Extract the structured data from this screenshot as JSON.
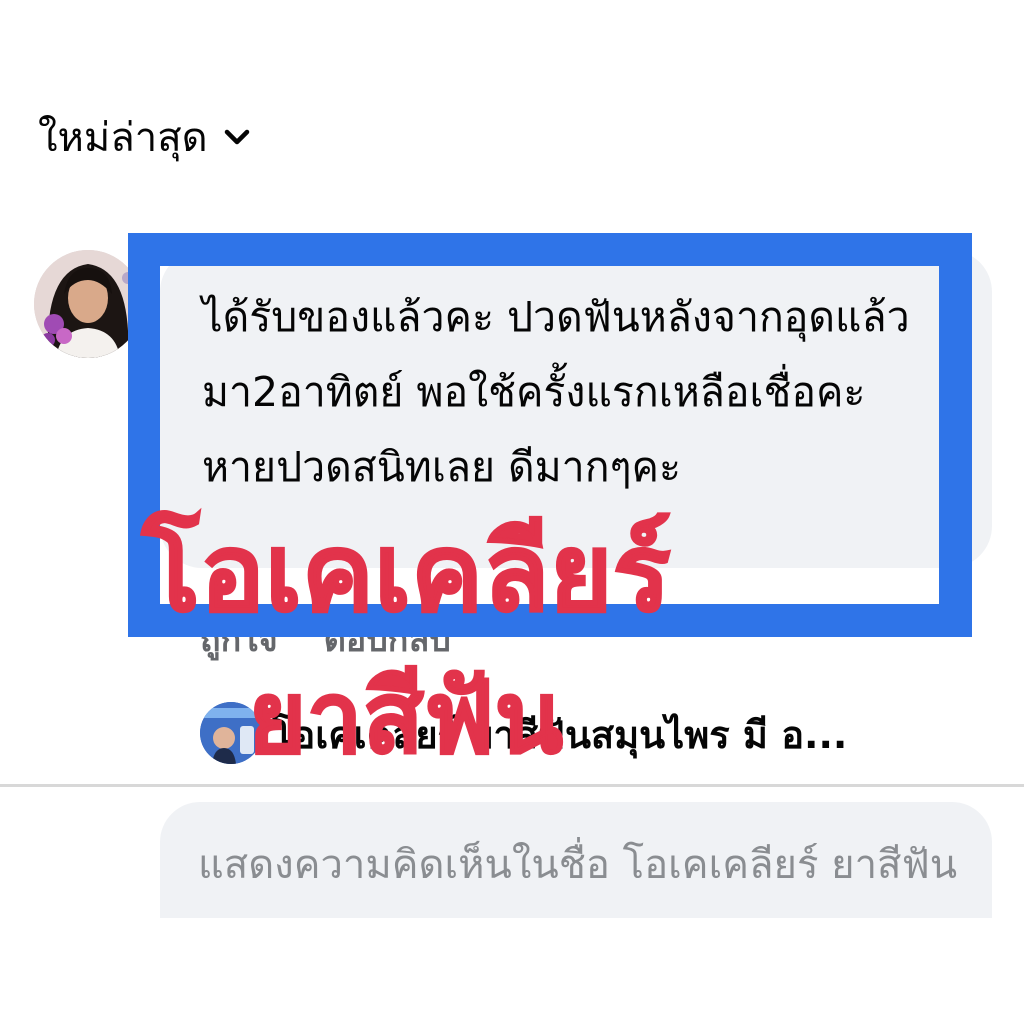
{
  "sort": {
    "label": "ใหม่ล่าสุด",
    "icon": "chevron-down-icon"
  },
  "comment": {
    "avatar_icon": "user-avatar",
    "text": "ได้รับของแล้วคะ ปวดฟันหลังจากอุดแล้วมา2อาทิตย์ พอใช้ครั้งแรกเหลือเชื่อคะ หายปวดสนิทเลย ดีมากๆคะ",
    "actions": {
      "like": "ถูกใจ",
      "reply": "ตอบกลับ"
    }
  },
  "reply": {
    "avatar_icon": "page-avatar",
    "text": "โอเคเคลียร์ ยาสีฟันสมุนไพร มี อ..."
  },
  "comment_input": {
    "placeholder": "แสดงความคิดเห็นในชื่อ โอเคเคลียร์ ยาสีฟัน"
  },
  "watermark": {
    "line1": "โอเคเคลียร์",
    "line2": "ยาสีฟัน"
  },
  "colors": {
    "highlight": "#2f74e8",
    "watermark": "#e2334b",
    "bubble": "#f0f2f5"
  }
}
